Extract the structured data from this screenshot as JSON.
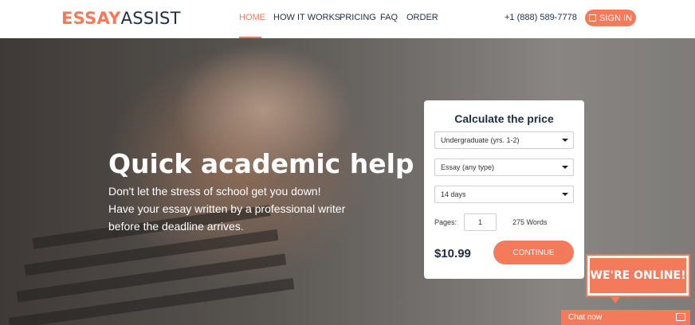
{
  "brand": {
    "logo_part1": "ESSAY",
    "logo_part2": "ASSIST"
  },
  "nav": {
    "items": [
      {
        "label": "HOME",
        "active": true
      },
      {
        "label": "HOW IT WORKS"
      },
      {
        "label": "PRICING"
      },
      {
        "label": "FAQ"
      },
      {
        "label": "ORDER"
      }
    ],
    "phone": "+1 (888) 589-7778",
    "signin_label": "SIGN IN"
  },
  "hero": {
    "title": "Quick academic help",
    "text": "Don't let the stress of school get you down! Have your essay written by a professional writer before the deadline arrives."
  },
  "calculator": {
    "title": "Calculate the price",
    "level_value": "Undergraduate (yrs. 1-2)",
    "type_value": "Essay (any type)",
    "deadline_value": "14 days",
    "pages_label": "Pages:",
    "pages_value": "1",
    "words_label": "275 Words",
    "price": "$10.99",
    "continue_label": "CONTINUE"
  },
  "chat": {
    "online_label": "WE'RE ONLINE!",
    "chat_label": "Chat now"
  },
  "colors": {
    "accent": "#f47a5c",
    "navy": "#1f2d44"
  }
}
